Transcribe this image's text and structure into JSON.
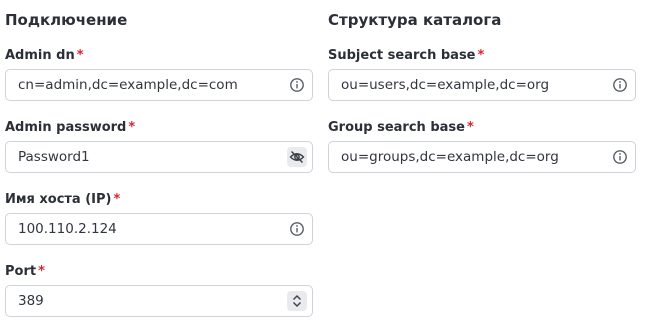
{
  "connection": {
    "title": "Подключение",
    "required_mark": "*",
    "fields": [
      {
        "label": "Admin dn",
        "value": "cn=admin,dc=example,dc=com",
        "icon": "info-icon"
      },
      {
        "label": "Admin password",
        "value": "Password1",
        "icon": "eye-off-icon"
      },
      {
        "label": "Имя хоста (IP)",
        "value": "100.110.2.124",
        "icon": "info-icon"
      },
      {
        "label": "Port",
        "value": "389",
        "icon": "spinner-arrows-icon"
      }
    ]
  },
  "catalog": {
    "title": "Структура каталога",
    "required_mark": "*",
    "fields": [
      {
        "label": "Subject search base",
        "value": "ou=users,dc=example,dc=org",
        "icon": "info-icon"
      },
      {
        "label": "Group search base",
        "value": "ou=groups,dc=example,dc=org",
        "icon": "info-icon"
      }
    ]
  },
  "colors": {
    "required": "#d8242c",
    "border": "#cfd2d8",
    "icon": "#5a5f6b"
  }
}
